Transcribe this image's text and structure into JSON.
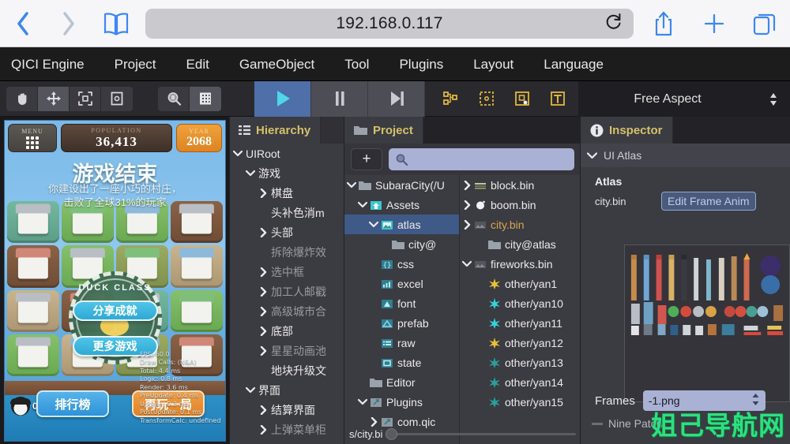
{
  "browser": {
    "url": "192.168.0.117",
    "back_icon": "chevron-left-icon",
    "forward_icon": "chevron-right-icon",
    "bookmarks_icon": "book-icon",
    "reload_icon": "reload-icon",
    "share_icon": "share-icon",
    "new_tab_icon": "plus-icon",
    "tabs_icon": "tabs-icon"
  },
  "menubar": {
    "items": [
      {
        "label": "QICI Engine"
      },
      {
        "label": "Project"
      },
      {
        "label": "Edit"
      },
      {
        "label": "GameObject"
      },
      {
        "label": "Tool"
      },
      {
        "label": "Plugins"
      },
      {
        "label": "Layout"
      },
      {
        "label": "Language"
      }
    ]
  },
  "toolbar": {
    "transform_tools": [
      {
        "name": "hand-tool",
        "selected": false
      },
      {
        "name": "move-tool",
        "selected": true
      },
      {
        "name": "scale-tool",
        "selected": false
      },
      {
        "name": "rect-tool",
        "selected": false
      }
    ],
    "view_tools": [
      {
        "name": "zoom-tool",
        "selected": false
      },
      {
        "name": "grid-tool",
        "selected": true
      }
    ],
    "playback": [
      {
        "name": "play-button",
        "active": true
      },
      {
        "name": "pause-button",
        "active": false
      },
      {
        "name": "step-button",
        "active": false
      }
    ],
    "gizmos": [
      {
        "name": "nodes-gizmo"
      },
      {
        "name": "bounds-gizmo"
      },
      {
        "name": "anchor-gizmo"
      },
      {
        "name": "text-gizmo"
      }
    ],
    "aspect_label": "Free Aspect",
    "aspect_icon": "updown-arrows-icon"
  },
  "game": {
    "hud": {
      "menu_label": "MENU",
      "population_label": "POPULATION",
      "population_value": "36,413",
      "year_label": "YEAR",
      "year_value": "2068"
    },
    "gameover_title": "游戏结束",
    "gameover_sub_line1": "你建设出了一座小巧的村庄，",
    "gameover_sub_line2": "击败了全球31%的玩家",
    "badge_text": "DUCK CLASS",
    "buttons": {
      "share": "分享成就",
      "more_games": "更多游戏",
      "rank": "排行榜",
      "replay": "再玩一局"
    },
    "avatar_count": "0",
    "stats": [
      "FPS: 60.0",
      "Draw Calls: (N&A)",
      "Total: 4.4 ms",
      "Logic: 0.8 ms",
      "Render: 3.6 ms",
      "PreUpdate: 0.4 ms",
      "Update: 0.3 ms",
      "PostUpdate: 0.1 ms",
      "TransformCalc: undefined"
    ]
  },
  "hierarchy": {
    "tab_label": "Hierarchy",
    "tab_icon": "list-icon",
    "nodes": [
      {
        "label": "UIRoot",
        "depth": 0,
        "arrow": "down",
        "dim": false
      },
      {
        "label": "游戏",
        "depth": 1,
        "arrow": "down",
        "dim": false
      },
      {
        "label": "棋盘",
        "depth": 2,
        "arrow": "right",
        "dim": false
      },
      {
        "label": "头补色消m",
        "depth": 2,
        "arrow": "none",
        "dim": false
      },
      {
        "label": "头部",
        "depth": 2,
        "arrow": "right",
        "dim": false
      },
      {
        "label": "拆除爆炸效",
        "depth": 2,
        "arrow": "none",
        "dim": true
      },
      {
        "label": "选中框",
        "depth": 2,
        "arrow": "right",
        "dim": true
      },
      {
        "label": "加工人邮戳",
        "depth": 2,
        "arrow": "right",
        "dim": true
      },
      {
        "label": "高级城市合",
        "depth": 2,
        "arrow": "right",
        "dim": true
      },
      {
        "label": "底部",
        "depth": 2,
        "arrow": "right",
        "dim": false
      },
      {
        "label": "星星动画池",
        "depth": 2,
        "arrow": "right",
        "dim": true
      },
      {
        "label": "地块升级文",
        "depth": 2,
        "arrow": "none",
        "dim": false
      },
      {
        "label": "界面",
        "depth": 1,
        "arrow": "down",
        "dim": false
      },
      {
        "label": "结算界面",
        "depth": 2,
        "arrow": "right",
        "dim": false
      },
      {
        "label": "上弹菜单柜",
        "depth": 2,
        "arrow": "right",
        "dim": true
      }
    ]
  },
  "project": {
    "tab_label": "Project",
    "tab_icon": "folder-icon",
    "add_button": "+",
    "search_placeholder": "",
    "search_icon": "search-icon",
    "tree": [
      {
        "label": "SubaraCity(/U",
        "depth": 0,
        "arrow": "down",
        "icon": "folder-icon",
        "sel": false
      },
      {
        "label": "Assets",
        "depth": 1,
        "arrow": "down",
        "icon": "assets-icon",
        "sel": false
      },
      {
        "label": "atlas",
        "depth": 2,
        "arrow": "down",
        "icon": "atlas-icon",
        "sel": true
      },
      {
        "label": "city@",
        "depth": 3,
        "arrow": "none",
        "icon": "folder-icon",
        "sel": false
      },
      {
        "label": "css",
        "depth": 2,
        "arrow": "none",
        "icon": "css-icon",
        "sel": false
      },
      {
        "label": "excel",
        "depth": 2,
        "arrow": "none",
        "icon": "excel-icon",
        "sel": false
      },
      {
        "label": "font",
        "depth": 2,
        "arrow": "none",
        "icon": "font-icon",
        "sel": false
      },
      {
        "label": "prefab",
        "depth": 2,
        "arrow": "none",
        "icon": "prefab-icon",
        "sel": false
      },
      {
        "label": "raw",
        "depth": 2,
        "arrow": "none",
        "icon": "raw-icon",
        "sel": false
      },
      {
        "label": "state",
        "depth": 2,
        "arrow": "none",
        "icon": "state-icon",
        "sel": false
      },
      {
        "label": "Editor",
        "depth": 1,
        "arrow": "none",
        "icon": "folder-icon",
        "sel": false
      },
      {
        "label": "Plugins",
        "depth": 1,
        "arrow": "down",
        "icon": "plugin-icon",
        "sel": false
      },
      {
        "label": "com.qic",
        "depth": 2,
        "arrow": "right",
        "icon": "plugin-icon",
        "sel": false
      }
    ],
    "assets": [
      {
        "label": "block.bin",
        "depth": 0,
        "arrow": "right",
        "icon": "bin-icon",
        "color": "normal"
      },
      {
        "label": "boom.bin",
        "depth": 0,
        "arrow": "right",
        "icon": "boom-icon",
        "color": "normal"
      },
      {
        "label": "city.bin",
        "depth": 0,
        "arrow": "right",
        "icon": "sprite-icon",
        "color": "orange"
      },
      {
        "label": "city@atlas",
        "depth": 1,
        "arrow": "none",
        "icon": "folder-icon",
        "color": "normal"
      },
      {
        "label": "fireworks.bin",
        "depth": 0,
        "arrow": "down",
        "icon": "sprite-icon",
        "color": "normal"
      },
      {
        "label": "other/yan1",
        "depth": 1,
        "arrow": "none",
        "icon": "spark-yellow-icon",
        "color": "normal"
      },
      {
        "label": "other/yan10",
        "depth": 1,
        "arrow": "none",
        "icon": "spark-cyan-icon",
        "color": "normal"
      },
      {
        "label": "other/yan11",
        "depth": 1,
        "arrow": "none",
        "icon": "spark-cyan-icon",
        "color": "normal"
      },
      {
        "label": "other/yan12",
        "depth": 1,
        "arrow": "none",
        "icon": "spark-yellow-icon",
        "color": "normal"
      },
      {
        "label": "other/yan13",
        "depth": 1,
        "arrow": "none",
        "icon": "spark-teal-icon",
        "color": "normal"
      },
      {
        "label": "other/yan14",
        "depth": 1,
        "arrow": "none",
        "icon": "spark-teal-icon",
        "color": "normal"
      },
      {
        "label": "other/yan15",
        "depth": 1,
        "arrow": "none",
        "icon": "spark-teal-icon",
        "color": "normal"
      }
    ],
    "path_text": "s/city.bi",
    "zoom_slider_value": "0"
  },
  "inspector": {
    "tab_label": "Inspector",
    "tab_icon": "info-icon",
    "section_label": "UI Atlas",
    "atlas_label": "Atlas",
    "atlas_value": "city.bin",
    "edit_frame_button": "Edit Frame Anim",
    "frames_label": "Frames",
    "frames_value": "-1.png",
    "frames_arrow_icon": "updown-arrows-icon",
    "nine_patch_label": "Nine Patch",
    "preview_name": "atlas-preview-image"
  },
  "watermark": "姐己导航网",
  "colors": {
    "accent_blue": "#3e86f5",
    "panel_bg": "#3b3b42",
    "tab_text": "#d3c26a",
    "selection": "#3f5a87",
    "orange_file": "#d6a84a",
    "play_active": "#4e6fa8",
    "watermark_green": "#2de07e"
  }
}
